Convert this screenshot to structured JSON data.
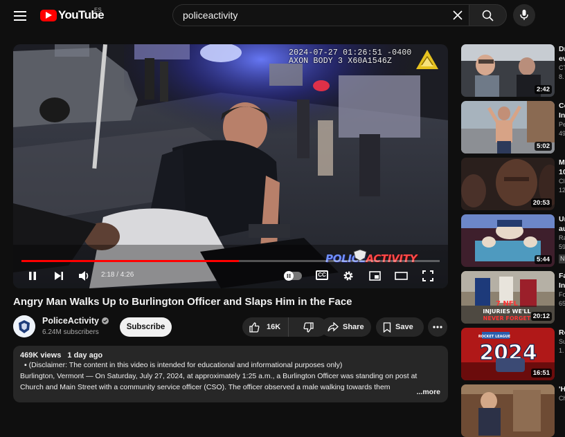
{
  "header": {
    "logo_text": "YouTube",
    "region": "ES",
    "search_value": "policeactivity"
  },
  "player": {
    "stamp_line1": "2024-07-27 01:26:51 -0400",
    "stamp_line2": "AXON BODY 3 X60A1546Z",
    "watermark_a": "POLICE",
    "watermark_b": "ACTIVITY",
    "time": "2:18 / 4:26",
    "progress": 0.52,
    "cc_label": "CC"
  },
  "video": {
    "title": "Angry Man Walks Up to Burlington Officer and Slaps Him in the Face",
    "channel": "PoliceActivity",
    "subscribers": "6.24M subscribers",
    "subscribe_label": "Subscribe",
    "likes": "16K",
    "share_label": "Share",
    "save_label": "Save"
  },
  "description": {
    "views": "469K views",
    "age": "1 day ago",
    "line1": "(Disclaimer: The content in this video is intended for educational and informational purposes only)",
    "line2": "Burlington, Vermont — On Saturday, July 27, 2024, at approximately 1:25 a.m., a Burlington Officer was standing on post at",
    "line3": "Church and Main Street with a community service officer (CSO). The officer observed a male walking towards them",
    "more_label": "...more"
  },
  "recommendations": [
    {
      "title": "Dr",
      "sub1": "ev",
      "sub2": "CT",
      "sub3": "8.",
      "duration": "2:42"
    },
    {
      "title": "Co",
      "sub1": "In",
      "sub2": "Pe",
      "sub3": "49",
      "duration": "5:02"
    },
    {
      "title": "M",
      "sub1": "10",
      "sub2": "Cl",
      "sub3": "12",
      "duration": "20:53"
    },
    {
      "title": "Ur",
      "sub1": "au",
      "sub2": "Ra",
      "sub3": "59",
      "badge": "N",
      "duration": "5:44"
    },
    {
      "title": "Fa",
      "sub1": "In",
      "sub2": "Fo",
      "sub3": "65",
      "duration": "20:12",
      "thumb_text1": "7 NFL",
      "thumb_text2": "INJURIES WE'LL",
      "thumb_text3": "NEVER FORGET"
    },
    {
      "title": "Ro",
      "sub1": "Su",
      "sub2": "1.",
      "duration": "16:51",
      "thumb_text1": "2024",
      "thumb_text2": "ROCKET LEAGUE"
    },
    {
      "title": "'H",
      "sub1": "Ch"
    }
  ],
  "colors": {
    "background": "#0f0f0f",
    "brand_red": "#ff0000",
    "pill": "#272727",
    "text_secondary": "#aaaaaa"
  }
}
